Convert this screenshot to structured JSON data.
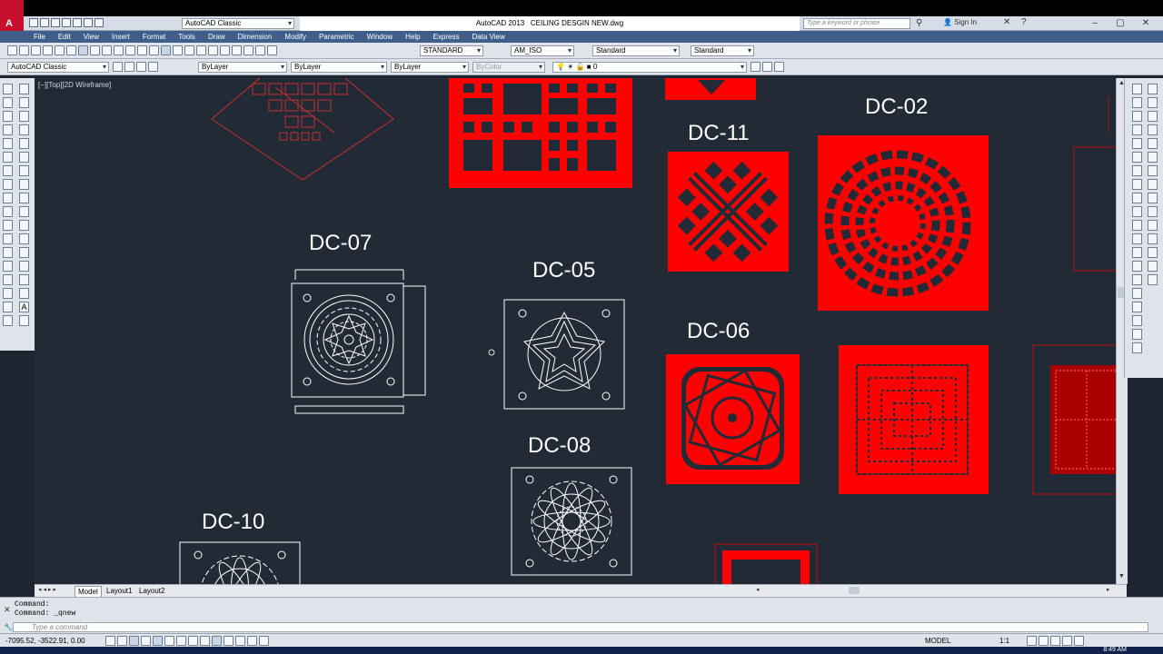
{
  "app": {
    "title": "AutoCAD 2013",
    "filename": "CEILING DESGIN NEW.dwg",
    "workspace": "AutoCAD Classic",
    "search_placeholder": "Type a keyword or phrase",
    "sign_in": "Sign In"
  },
  "menu": [
    "File",
    "Edit",
    "View",
    "Insert",
    "Format",
    "Tools",
    "Draw",
    "Dimension",
    "Modify",
    "Parametric",
    "Window",
    "Help",
    "Express",
    "Data View"
  ],
  "styles": {
    "text_style": "STANDARD",
    "dim_style": "AM_ISO",
    "table_style": "Standard",
    "mleader_style": "Standard"
  },
  "layers": {
    "workspace": "AutoCAD Classic",
    "color": "ByLayer",
    "linetype": "ByLayer",
    "lineweight": "ByLayer",
    "plotstyle": "ByColor",
    "layer": "0"
  },
  "viewport_label": "[−][Top][2D Wireframe]",
  "drawings": {
    "dc07": "DC-07",
    "dc05": "DC-05",
    "dc08": "DC-08",
    "dc10": "DC-10",
    "dc11": "DC-11",
    "dc06": "DC-06",
    "dc02": "DC-02"
  },
  "layout_tabs": [
    "Model",
    "Layout1",
    "Layout2"
  ],
  "command_history": [
    "Command:",
    "Command:  _qnew"
  ],
  "command_placeholder": "Type a command",
  "status": {
    "coords": "-7095.52, -3522.91, 0.00",
    "space": "MODEL",
    "scale": "1:1",
    "clock": "8:49 AM"
  },
  "colors": {
    "canvas": "#222a35",
    "red_fill": "#ff0000",
    "white_linework": "#ffffff"
  }
}
